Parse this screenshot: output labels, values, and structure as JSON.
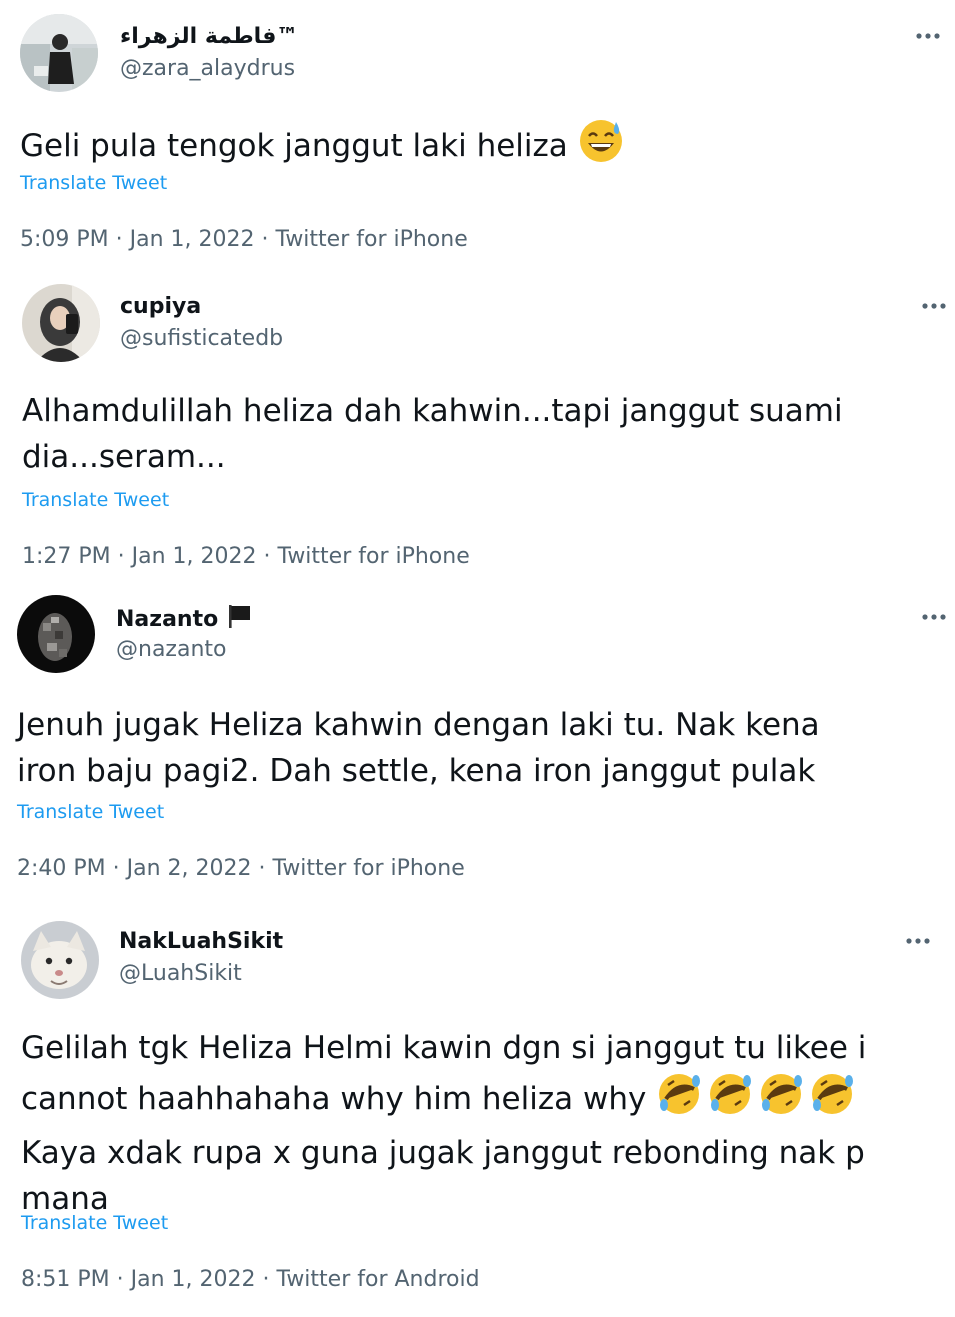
{
  "tweets": [
    {
      "display_name": "فاطمة الزهراء™",
      "handle": "@zara_alaydrus",
      "text_lines": [
        "Geli pula tengok janggut laki heliza"
      ],
      "emoji": "grinning-face-with-sweat",
      "translate_label": "Translate Tweet",
      "time": "5:09 PM",
      "date": "Jan 1, 2022",
      "source": "Twitter for iPhone"
    },
    {
      "display_name": "cupiya",
      "handle": "@sufisticatedb",
      "text_lines": [
        "Alhamdulillah heliza dah kahwin...tapi janggut suami",
        "dia...seram..."
      ],
      "translate_label": "Translate Tweet",
      "time": "1:27 PM",
      "date": "Jan 1, 2022",
      "source": "Twitter for iPhone"
    },
    {
      "display_name": "Nazanto",
      "name_icon": "black-flag-icon",
      "handle": "@nazanto",
      "text_lines": [
        "Jenuh jugak Heliza kahwin dengan laki tu. Nak kena",
        "iron baju pagi2. Dah settle, kena iron janggut pulak"
      ],
      "translate_label": "Translate Tweet",
      "time": "2:40 PM",
      "date": "Jan 2, 2022",
      "source": "Twitter for iPhone"
    },
    {
      "display_name": "NakLuahSikit",
      "handle": "@LuahSikit",
      "text_lines": [
        "Gelilah tgk Heliza Helmi kawin dgn si janggut tu likee i",
        "cannot haahhahaha why him heliza why",
        "Kaya xdak rupa x guna jugak janggut rebonding nak p",
        "mana"
      ],
      "emoji": "rolling-on-the-floor-laughing x4",
      "translate_label": "Translate Tweet",
      "time": "8:51 PM",
      "date": "Jan 1, 2022",
      "source": "Twitter for Android"
    }
  ],
  "meta_separator": " · ",
  "colors": {
    "text": "#0f1419",
    "secondary": "#536471",
    "link": "#1d9bf0"
  }
}
